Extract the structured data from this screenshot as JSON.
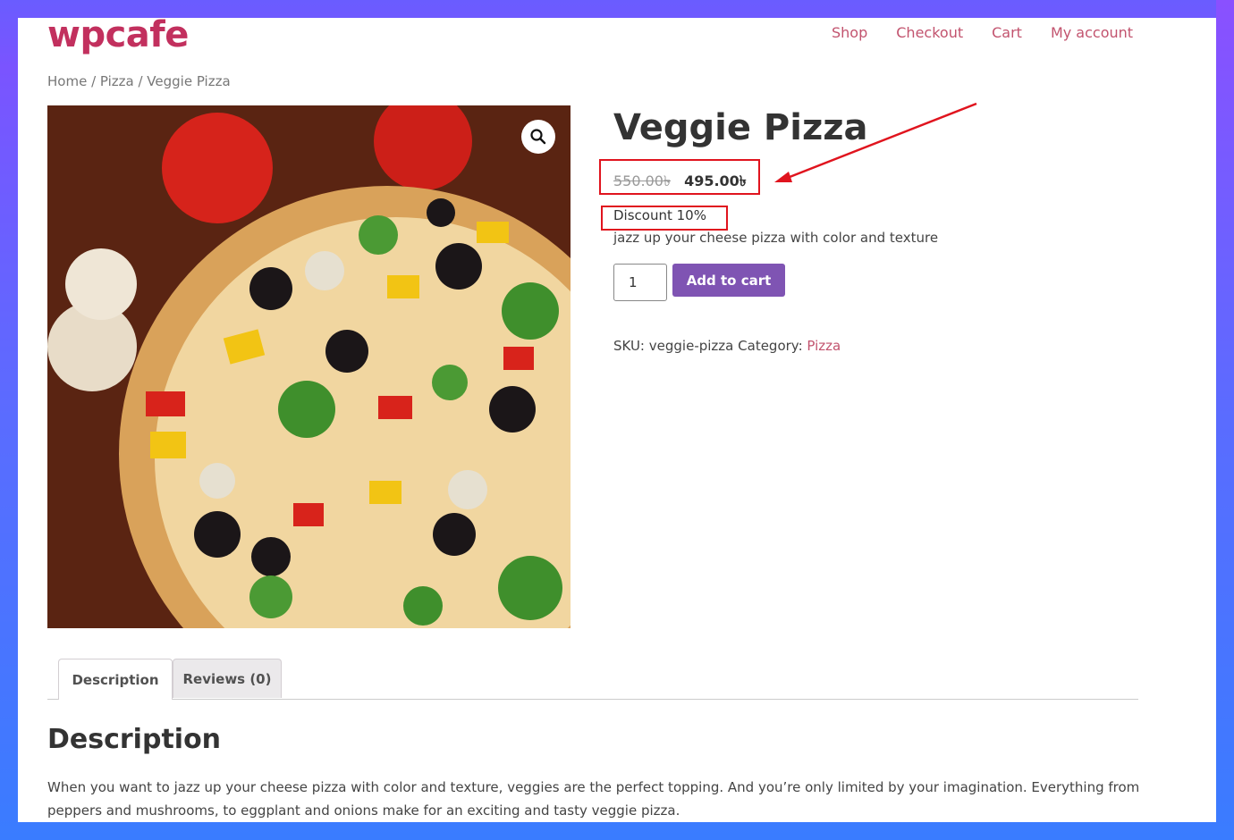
{
  "site": {
    "logo": "wpcafe"
  },
  "nav": {
    "items": [
      "Shop",
      "Checkout",
      "Cart",
      "My account"
    ]
  },
  "breadcrumb": "Home / Pizza / Veggie Pizza",
  "product": {
    "title": "Veggie Pizza",
    "regular_price": "550.00৳",
    "sale_price": "495.00৳",
    "discount": "Discount 10%",
    "short_description": "jazz up your cheese pizza with color and texture",
    "quantity": "1",
    "add_to_cart_label": "Add to cart",
    "sku_label": "SKU:",
    "sku": "veggie-pizza",
    "category_label": "Category:",
    "category": "Pizza",
    "image_alt": "Veggie pizza with tomatoes, olives, broccoli, peppers and mushrooms"
  },
  "tabs": [
    {
      "label": "Description",
      "active": true
    },
    {
      "label": "Reviews (0)",
      "active": false
    }
  ],
  "description": {
    "heading": "Description",
    "body": "When you want to jazz up your cheese pizza with color and texture, veggies are the perfect topping. And you’re only limited by your imagination. Everything from peppers and mushrooms, to eggplant and onions make for an exciting and tasty veggie pizza."
  },
  "colors": {
    "brand": "#c2305e",
    "link": "#c2536e",
    "button": "#7f54b3",
    "annotation": "#e0141e"
  }
}
